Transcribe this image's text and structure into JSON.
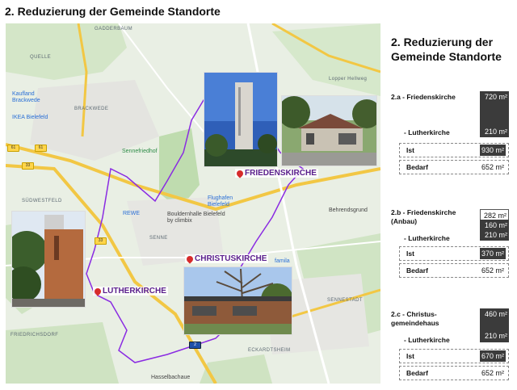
{
  "slide_title": "2. Reduzierung der Gemeinde Standorte",
  "panel_title": "2. Reduzierung der Gemeinde Standorte",
  "map": {
    "places": {
      "gadderbaum": "GADDERBAUM",
      "quelle": "QUELLE",
      "brackwede": "BRACKWEDE",
      "kaufland": "Kaufland Brackwede",
      "ikea": "IKEA Bielefeld",
      "sennefriedhof": "Sennefriedhof",
      "rewe": "REWE",
      "bouldern": "Bouldernhalle Bielefeld by climbix",
      "flughafen": "Flughafen Bielefeld",
      "sudwestfeld": "SÜDWESTFELD",
      "friedrichsdorf": "FRIEDRICHSDORF",
      "hasselbachaue": "Hasselbachaue",
      "sennestadt": "SENNESTADT",
      "eckardtsheim": "ECKARDTSHEIM",
      "behrendsgrund": "Behrendsgrund",
      "famila": "famila",
      "lopper": "Lopper Hellweg",
      "senne": "SENNE"
    },
    "routes": [
      "61",
      "61",
      "33",
      "33",
      "2"
    ],
    "church_labels": {
      "friedenskirche": "FRIEDENSKIRCHE",
      "christuskirche": "CHRISTUSKIRCHE",
      "lutherkirche": "LUTHERKIRCHE"
    }
  },
  "panel": {
    "a": {
      "label": "2.a - Friedenskirche",
      "friedenskirche_value": "720 m²",
      "luther_label": "- Lutherkirche",
      "luther_value": "210 m²",
      "ist_label": "Ist",
      "ist_value": "930 m²",
      "bedarf_label": "Bedarf",
      "bedarf_value": "652 m²"
    },
    "b": {
      "label": "2.b - Friedenskirche (Anbau)",
      "value_1": "282 m²",
      "value_2": "160 m²",
      "luther_label": "- Lutherkirche",
      "luther_value": "210 m²",
      "ist_label": "Ist",
      "ist_value": "370 m²",
      "bedarf_label": "Bedarf",
      "bedarf_value": "652 m²"
    },
    "c": {
      "label": "2.c - Christus- gemeindehaus",
      "christus_value": "460 m²",
      "luther_label": "- Lutherkirche",
      "luther_value": "210 m²",
      "ist_label": "Ist",
      "ist_value": "670 m²",
      "bedarf_label": "Bedarf",
      "bedarf_value": "652 m²"
    }
  }
}
